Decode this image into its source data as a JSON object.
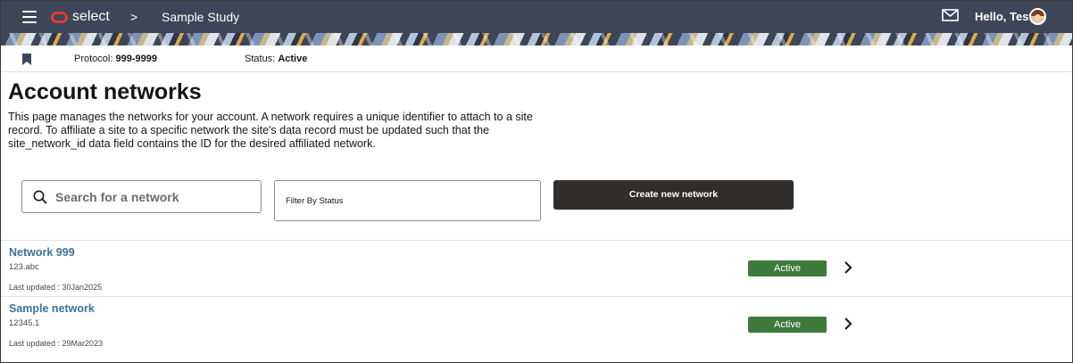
{
  "header": {
    "app_name": "select",
    "separator": ">",
    "study_name": "Sample Study",
    "greeting": "Hello, Test",
    "brand_color": "#e23b2c",
    "bar_color": "#3d4558"
  },
  "protocol_bar": {
    "protocol_label": "Protocol:",
    "protocol_value": "999-9999",
    "status_label": "Status:",
    "status_value": "Active"
  },
  "page": {
    "title": "Account networks",
    "description": "This page manages the networks for your account. A network requires a unique identifier to attach to a site record. To affiliate a site to a specific network the site's data record must be updated such that the site_network_id data field contains the ID for the desired affiliated network."
  },
  "controls": {
    "search_placeholder": "Search for a network",
    "filter_label": "Filter By Status",
    "create_button": "Create new network"
  },
  "networks": [
    {
      "name": "Network 999",
      "identifier": "123.abc",
      "last_updated": "Last updated : 30Jan2025",
      "status": "Active"
    },
    {
      "name": "Sample network",
      "identifier": "12345.1",
      "last_updated": "Last updated : 29Mar2023",
      "status": "Active"
    }
  ],
  "colors": {
    "active_badge": "#3f7a3d",
    "link": "#3e7399",
    "primary_button": "#312d2a"
  },
  "icons": [
    "menu-icon",
    "mail-icon",
    "avatar",
    "bookmark-icon",
    "search-icon",
    "chevron-right-icon"
  ]
}
